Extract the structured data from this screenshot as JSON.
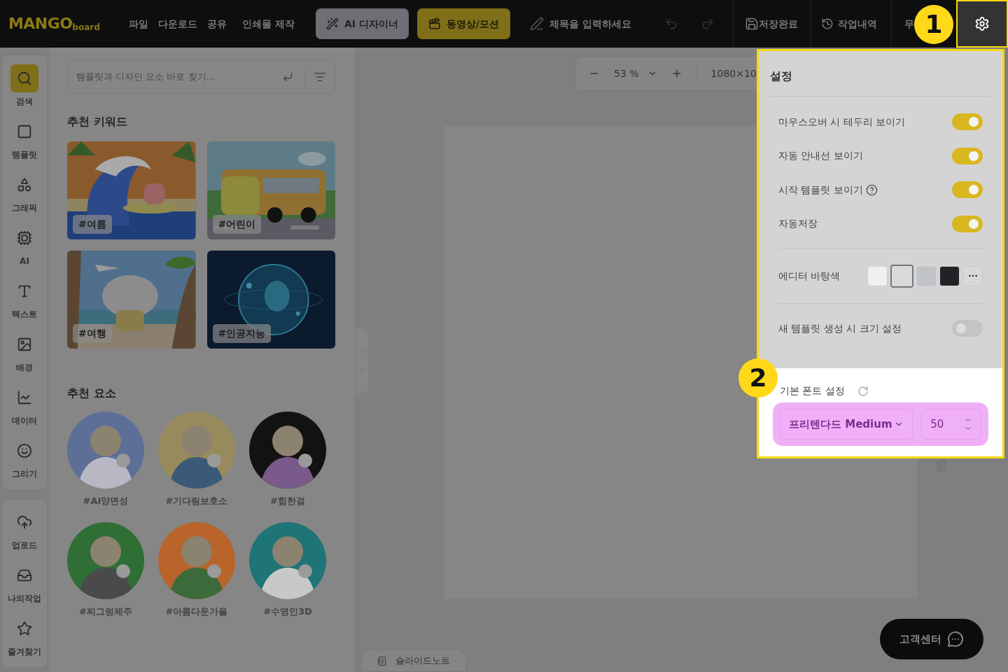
{
  "header": {
    "logo": {
      "main": "MANGO",
      "sub": "board"
    },
    "menu": [
      "파일",
      "다운로드",
      "공유",
      "인쇄물 제작"
    ],
    "ai_button": "AI 디자이너",
    "motion_button": "동영상/모션",
    "title_field": {
      "placeholder": "제목을 입력하세요"
    },
    "save_status": "저장완료",
    "history": "작업내역",
    "cut_item": "무"
  },
  "rail": {
    "groups": [
      [
        {
          "label": "검색",
          "kind": "search",
          "selected": true
        },
        {
          "label": "템플릿",
          "kind": "template",
          "selected": false
        },
        {
          "label": "그래픽",
          "kind": "graphic",
          "selected": false
        },
        {
          "label": "AI",
          "kind": "ai",
          "selected": false
        },
        {
          "label": "텍스트",
          "kind": "text",
          "selected": false
        },
        {
          "label": "배경",
          "kind": "background",
          "selected": false
        },
        {
          "label": "데이터",
          "kind": "data",
          "selected": false
        },
        {
          "label": "그리기",
          "kind": "draw",
          "selected": false
        }
      ],
      [
        {
          "label": "업로드",
          "kind": "upload",
          "selected": false
        },
        {
          "label": "나의작업",
          "kind": "mywork",
          "selected": false
        },
        {
          "label": "즐겨찾기",
          "kind": "favorite",
          "selected": false
        }
      ]
    ]
  },
  "search": {
    "placeholder": "템플릿과 디자인 요소 바로 찾기..."
  },
  "keywords": {
    "title": "추천 키워드",
    "items": [
      {
        "tag": "#여름",
        "kind": "beach"
      },
      {
        "tag": "#어린이",
        "kind": "bus"
      },
      {
        "tag": "#여행",
        "kind": "island"
      },
      {
        "tag": "#인공지능",
        "kind": "globe"
      }
    ]
  },
  "elements": {
    "title": "추천 요소",
    "items": [
      {
        "tag": "#AI양면성",
        "color": "#5e6f97"
      },
      {
        "tag": "#기다림보호소",
        "color": "#978a5c"
      },
      {
        "tag": "#힙한걸",
        "color": "#121212"
      },
      {
        "tag": "#찌그렁제주",
        "color": "#2f6e34"
      },
      {
        "tag": "#아름다운가을",
        "color": "#b8642a"
      },
      {
        "tag": "#수영인3D",
        "color": "#1f7478"
      }
    ]
  },
  "zoom_bar": {
    "zoom": "53 %",
    "size": "1080×10"
  },
  "settings": {
    "title": "설정",
    "toggles": [
      {
        "label": "마우스오버 시 테두리 보이기",
        "on": true,
        "help": false
      },
      {
        "label": "자동 안내선 보이기",
        "on": true,
        "help": false
      },
      {
        "label": "시작 템플릿 보이기",
        "on": true,
        "help": true
      },
      {
        "label": "자동저장",
        "on": true,
        "help": false
      }
    ],
    "bg_color": {
      "label": "에디터 바탕색",
      "swatches": [
        {
          "color": "#f0f0f0",
          "selected": false
        },
        {
          "color": "#d9d9d9",
          "selected": true
        },
        {
          "color": "#c0c3c7",
          "selected": false
        },
        {
          "color": "#222226",
          "selected": false
        }
      ]
    },
    "size_toggle": {
      "label": "새 템플릿 생성 시 크기 설정",
      "on": false
    },
    "font": {
      "label": "기본 폰트 설정",
      "family": "프리텐다드 Medium",
      "size": "50"
    }
  },
  "tutorial": {
    "badges": [
      "1",
      "2"
    ]
  },
  "slide_notes": "슬라이드노트",
  "help_center": "고객센터"
}
